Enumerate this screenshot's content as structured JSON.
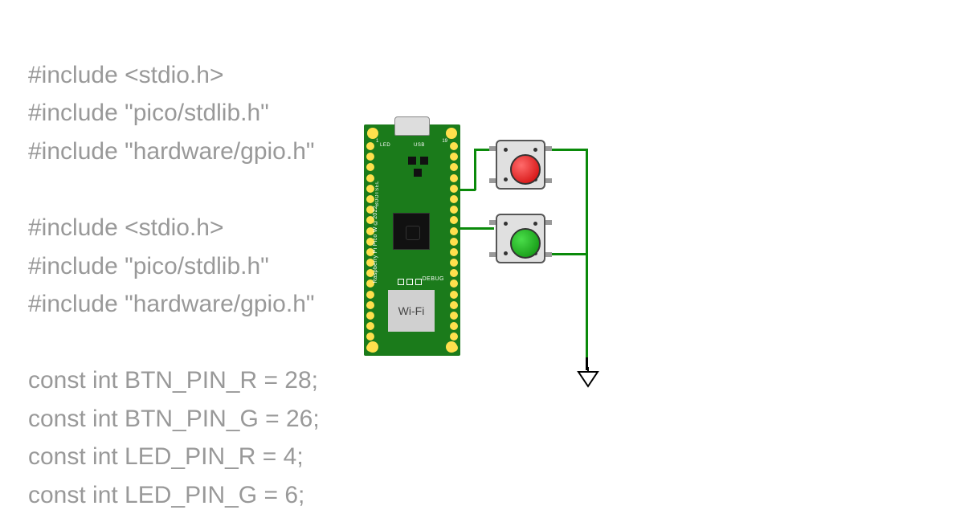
{
  "code": {
    "line1": "#include <stdio.h>",
    "line2": "#include \"pico/stdlib.h\"",
    "line3": "#include \"hardware/gpio.h\"",
    "line4": "#include <stdio.h>",
    "line5": "#include \"pico/stdlib.h\"",
    "line6": "#include \"hardware/gpio.h\"",
    "line7": "const int BTN_PIN_R = 28;",
    "line8": "const int BTN_PIN_G = 26;",
    "line9": "const int LED_PIN_R = 4;",
    "line10": "const int LED_PIN_G = 6;"
  },
  "board": {
    "wifi_label": "Wi-Fi",
    "debug_label": "DEBUG",
    "usb_label": "USB",
    "led_label": "LED",
    "bootsel_label": "BOOTSEL",
    "side_text": "Raspberry Pi Pico W ©2022",
    "pin_top_left": "1",
    "pin_top_right": "19"
  },
  "components": {
    "button_red": {
      "color": "#cc0000",
      "connected_pin": 28
    },
    "button_green": {
      "color": "#0a8a0a",
      "connected_pin": 26
    }
  }
}
